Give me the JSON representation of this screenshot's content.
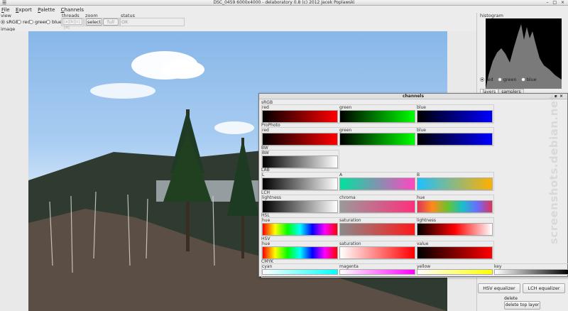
{
  "window": {
    "title": "DSC_0459 6000x4000 - delaboratory 0.8 (c) 2012 Jacek Poplawski",
    "menu_glyph": "☰",
    "controls": "– □ ×"
  },
  "menu": {
    "file": "File",
    "export": "Export",
    "palette": "Palette",
    "channels": "Channels"
  },
  "toolbar": {
    "view": {
      "label": "view",
      "options": [
        "sRGB",
        "red",
        "green",
        "blue"
      ],
      "selected": "sRGB"
    },
    "threads": {
      "label": "threads",
      "value": "[a][b][c][d]"
    },
    "zoom": {
      "label": "zoom",
      "select": "select",
      "full": "full"
    },
    "status": {
      "label": "status",
      "value": "OK"
    }
  },
  "image": {
    "label": "image"
  },
  "histogram": {
    "label": "histogram",
    "channels": [
      "red",
      "green",
      "blue"
    ],
    "selected": "red",
    "fill_color": "#7a7a7a"
  },
  "tabs": {
    "layers": "layers",
    "samplers": "samplers"
  },
  "channels_window": {
    "title": "channels",
    "sections": [
      {
        "name": "sRGB",
        "channels": [
          {
            "label": "red",
            "gradient": [
              "#000000",
              "#ff0000"
            ]
          },
          {
            "label": "green",
            "gradient": [
              "#000000",
              "#00ff00"
            ]
          },
          {
            "label": "blue",
            "gradient": [
              "#000000",
              "#0000ff"
            ]
          }
        ]
      },
      {
        "name": "ProPhoto",
        "channels": [
          {
            "label": "red",
            "gradient": [
              "#000000",
              "#ff0000"
            ]
          },
          {
            "label": "green",
            "gradient": [
              "#000000",
              "#00ff00"
            ]
          },
          {
            "label": "blue",
            "gradient": [
              "#000000",
              "#0000ff"
            ]
          }
        ]
      },
      {
        "name": "BW",
        "channels": [
          {
            "label": "BW",
            "gradient": [
              "#000000",
              "#ffffff"
            ]
          }
        ]
      },
      {
        "name": "LAB",
        "channels": [
          {
            "label": "L",
            "gradient": [
              "#000000",
              "#ffffff"
            ]
          },
          {
            "label": "A",
            "gradient": [
              "#00e2a0",
              "#ff46c0"
            ]
          },
          {
            "label": "B",
            "gradient": [
              "#1ec0ff",
              "#ffb000"
            ]
          }
        ]
      },
      {
        "name": "LCH",
        "channels": [
          {
            "label": "lightness",
            "gradient": [
              "#000000",
              "#ffffff"
            ]
          },
          {
            "label": "chroma",
            "gradient": [
              "#9a9a9a",
              "#ff2f7c"
            ]
          },
          {
            "label": "hue",
            "gradient": [
              "#e0335a",
              "#ff8a1a",
              "#6ec22a",
              "#18c0c8",
              "#6a6cff",
              "#e0335a"
            ]
          }
        ]
      },
      {
        "name": "HSL",
        "channels": [
          {
            "label": "hue",
            "gradient": [
              "#ff0000",
              "#ffff00",
              "#00ff00",
              "#00ffff",
              "#0000ff",
              "#ff00ff",
              "#ff0000"
            ]
          },
          {
            "label": "saturation",
            "gradient": [
              "#8a8a8a",
              "#ff1a1a"
            ]
          },
          {
            "label": "lightness",
            "gradient": [
              "#000000",
              "#ff0000",
              "#ffffff"
            ]
          }
        ]
      },
      {
        "name": "HSV",
        "channels": [
          {
            "label": "hue",
            "gradient": [
              "#ff0000",
              "#ffff00",
              "#00ff00",
              "#00ffff",
              "#0000ff",
              "#ff00ff",
              "#ff0000"
            ]
          },
          {
            "label": "saturation",
            "gradient": [
              "#ffffff",
              "#ff0000"
            ]
          },
          {
            "label": "value",
            "gradient": [
              "#000000",
              "#ff0000"
            ]
          }
        ]
      },
      {
        "name": "CMYK",
        "channels": [
          {
            "label": "cyan",
            "gradient": [
              "#ffffff",
              "#00ffff"
            ]
          },
          {
            "label": "magenta",
            "gradient": [
              "#ffffff",
              "#ff00ff"
            ]
          },
          {
            "label": "yellow",
            "gradient": [
              "#ffffff",
              "#ffff00"
            ]
          },
          {
            "label": "key",
            "gradient": [
              "#ffffff",
              "#000000"
            ]
          }
        ]
      }
    ]
  },
  "equalizers": {
    "hsv": "HSV equalizer",
    "lch": "LCH equalizer"
  },
  "delete": {
    "label": "delete",
    "button": "delete top layer"
  },
  "watermark": "screenshots.debian.net"
}
